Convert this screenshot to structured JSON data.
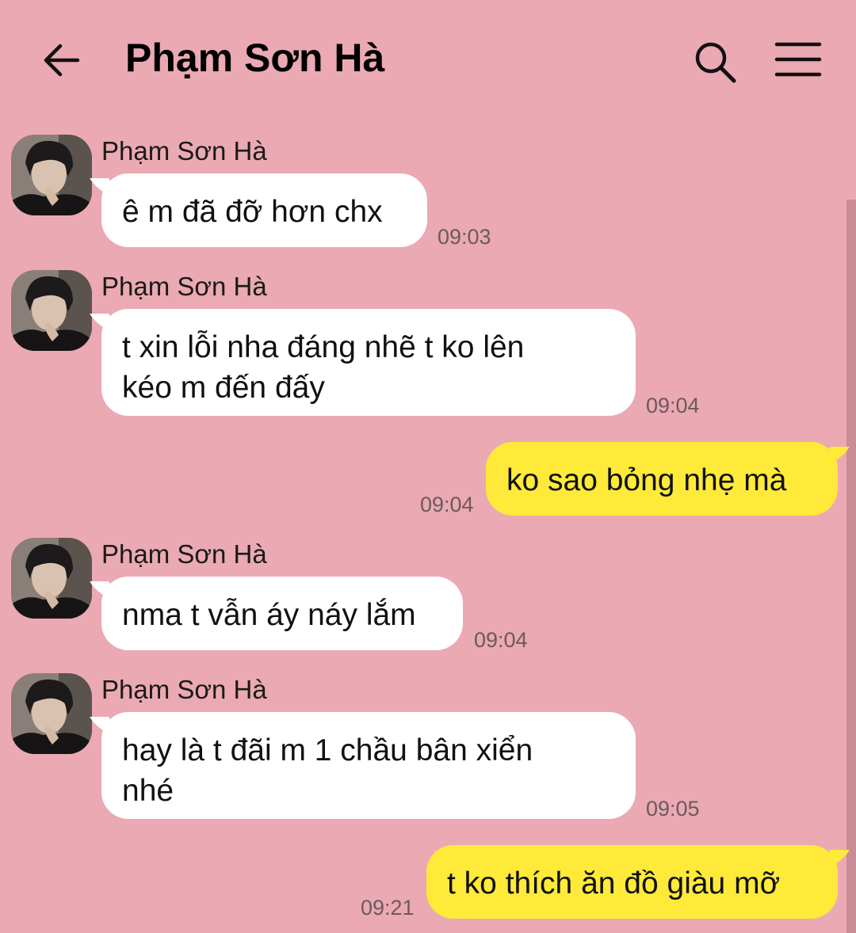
{
  "header": {
    "title": "Phạm Sơn Hà",
    "back_icon": "arrow-left-icon",
    "search_icon": "search-icon",
    "menu_icon": "hamburger-menu-icon"
  },
  "colors": {
    "background": "#eba9b3",
    "incoming_bubble": "#ffffff",
    "outgoing_bubble": "#ffea3a"
  },
  "messages": [
    {
      "direction": "in",
      "sender": "Phạm Sơn Hà",
      "text": "ê m đã đỡ hơn chx",
      "time": "09:03"
    },
    {
      "direction": "in",
      "sender": "Phạm Sơn Hà",
      "text": "t xin lỗi nha đáng nhẽ t ko lên\nkéo m đến đấy",
      "time": "09:04"
    },
    {
      "direction": "out",
      "text": "ko sao bỏng nhẹ mà",
      "time": "09:04"
    },
    {
      "direction": "in",
      "sender": "Phạm Sơn Hà",
      "text": "nma t vẫn áy náy lắm",
      "time": "09:04"
    },
    {
      "direction": "in",
      "sender": "Phạm Sơn Hà",
      "text": "hay là t đãi m 1 chầu bân xiển\nnhé",
      "time": "09:05"
    },
    {
      "direction": "out",
      "text": "t ko thích ăn đồ giàu mỡ",
      "time": "09:21"
    }
  ]
}
